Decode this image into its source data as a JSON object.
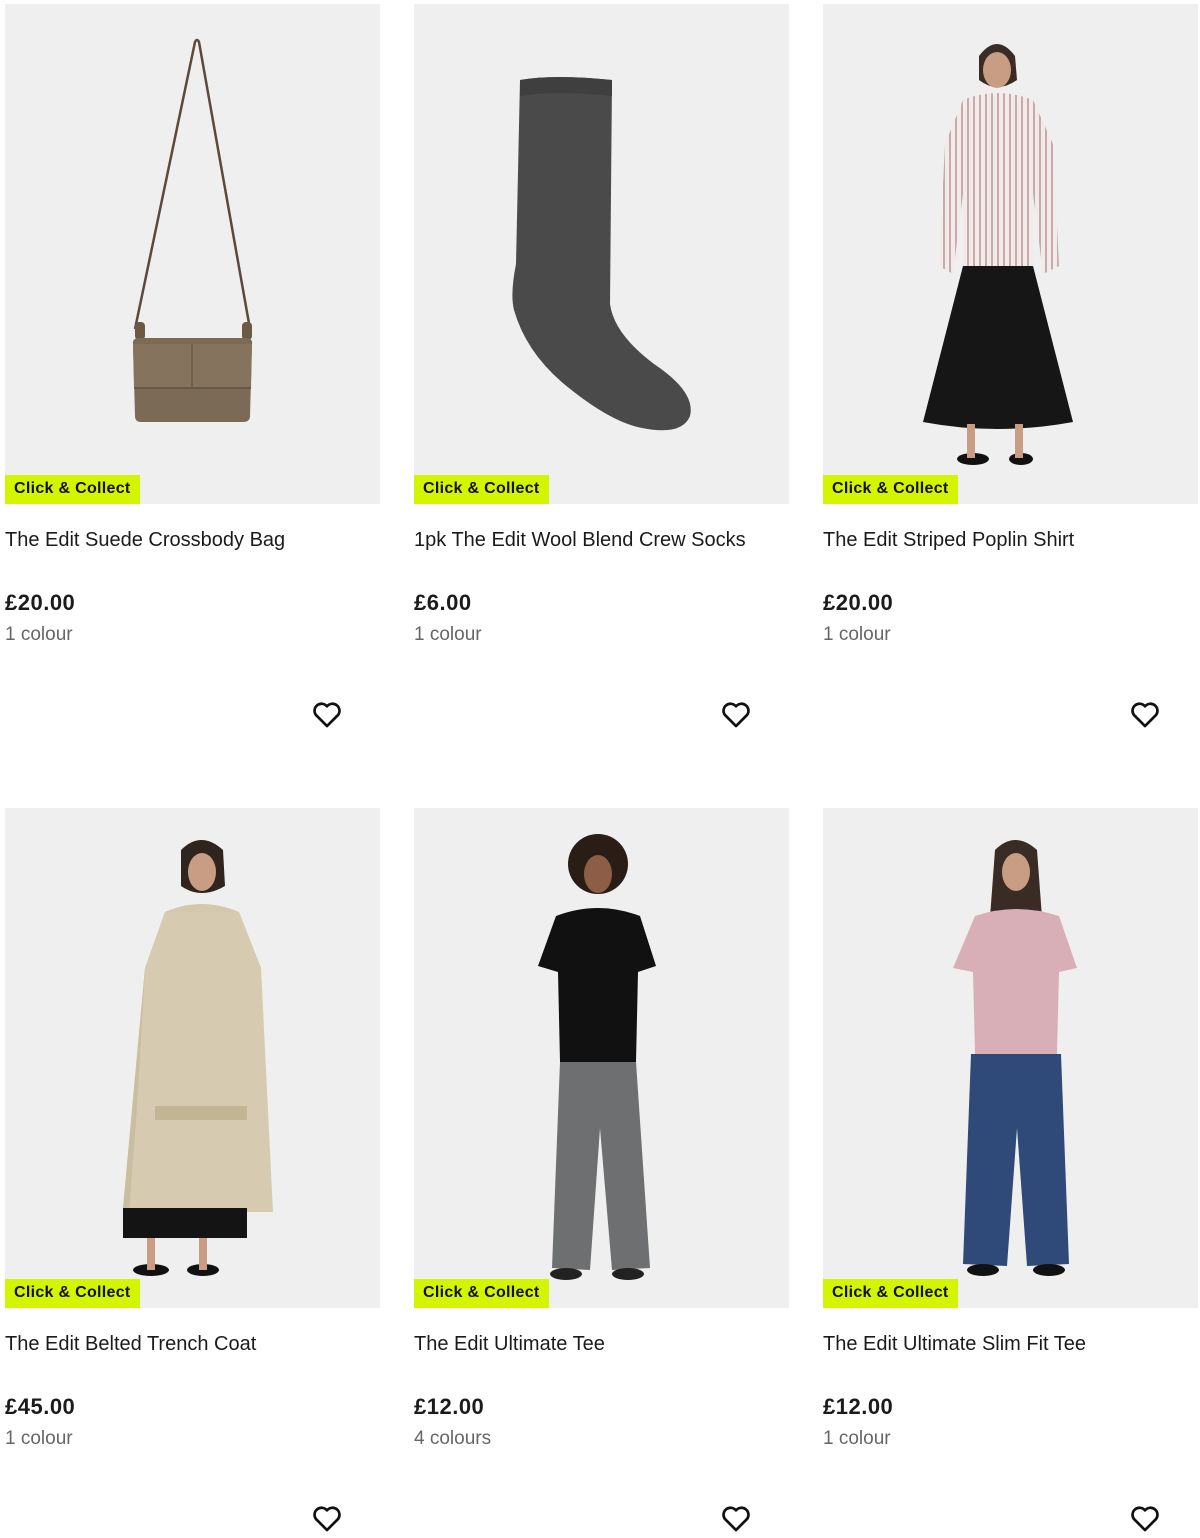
{
  "products": [
    {
      "title": "The Edit Suede Crossbody Bag",
      "price": "£20.00",
      "colours": "1 colour",
      "badge": "Click & Collect"
    },
    {
      "title": "1pk The Edit Wool Blend Crew Socks",
      "price": "£6.00",
      "colours": "1 colour",
      "badge": "Click & Collect"
    },
    {
      "title": "The Edit Striped Poplin Shirt",
      "price": "£20.00",
      "colours": "1 colour",
      "badge": "Click & Collect"
    },
    {
      "title": "The Edit Belted Trench Coat",
      "price": "£45.00",
      "colours": "1 colour",
      "badge": "Click & Collect"
    },
    {
      "title": "The Edit Ultimate Tee",
      "price": "£12.00",
      "colours": "4 colours",
      "badge": "Click & Collect"
    },
    {
      "title": "The Edit Ultimate Slim Fit Tee",
      "price": "£12.00",
      "colours": "1 colour",
      "badge": "Click & Collect"
    }
  ],
  "colors": {
    "badge_bg": "#d4f500",
    "image_bg": "#efefef",
    "text": "#1b1b1b",
    "muted": "#666666"
  },
  "icons": {
    "favourite": "heart-outline-icon"
  }
}
